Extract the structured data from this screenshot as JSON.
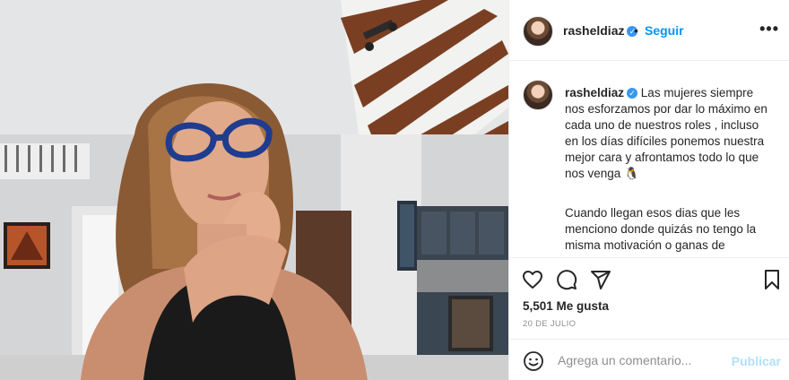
{
  "post": {
    "username": "rasheldiaz",
    "verified": true,
    "follow_label": "Seguir",
    "dot": "•",
    "more_label": "•••",
    "caption": {
      "username": "rasheldiaz",
      "paragraph1": "Las mujeres siempre nos esforzamos por dar lo máximo en cada uno de nuestros roles , incluso en los días difíciles ponemos nuestra mejor cara y afrontamos todo lo que nos venga 🐧",
      "paragraph2": "Cuando llegan esos dias que les menciono donde quizás no tengo la misma motivación o ganas de"
    },
    "likes": "5,501 Me gusta",
    "date": "20 DE JULIO",
    "comment": {
      "placeholder": "Agrega un comentario...",
      "publish_label": "Publicar"
    }
  },
  "icons": {
    "like": "heart-outline-icon",
    "comment": "speech-bubble-icon",
    "share": "paper-plane-icon",
    "save": "bookmark-icon",
    "emoji": "smiley-icon"
  },
  "colors": {
    "accent": "#0095f6",
    "verified": "#3897f0",
    "publish_disabled": "#b2dffc",
    "muted": "#8e8e8e"
  }
}
